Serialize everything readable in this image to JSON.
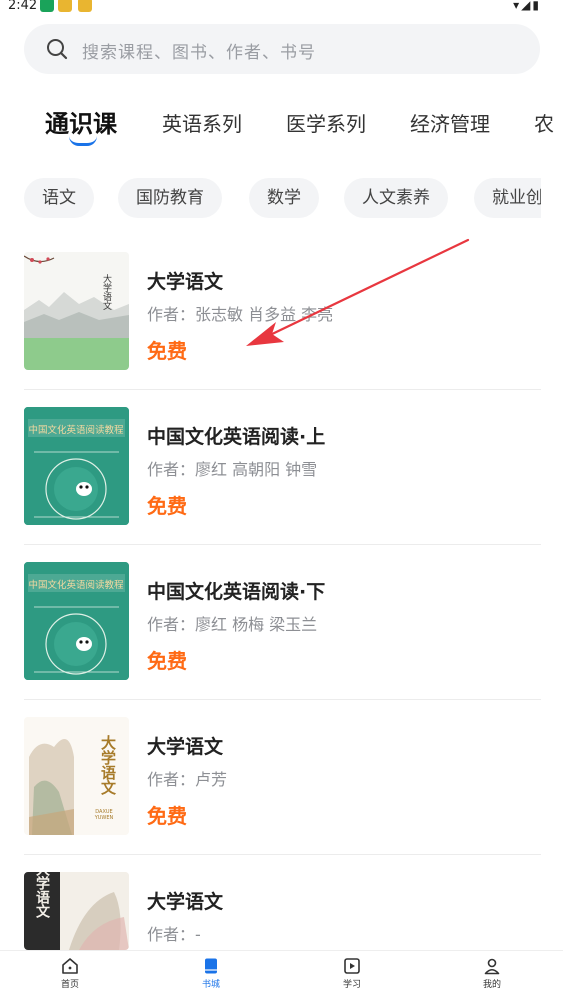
{
  "status": {
    "time": "2:42",
    "right_icons": "wifi signal battery"
  },
  "search": {
    "placeholder": "搜索课程、图书、作者、书号"
  },
  "tabs": [
    {
      "label": "通识课",
      "active": true
    },
    {
      "label": "英语系列",
      "active": false
    },
    {
      "label": "医学系列",
      "active": false
    },
    {
      "label": "经济管理",
      "active": false
    },
    {
      "label": "农",
      "active": false
    }
  ],
  "chips": [
    "语文",
    "国防教育",
    "数学",
    "人文素养",
    "就业创"
  ],
  "books": [
    {
      "title": "大学语文",
      "author": "作者：张志敏 肖多益 李亮",
      "price": "免费",
      "cover": "landscape"
    },
    {
      "title": "中国文化英语阅读·上",
      "author": "作者：廖红 高朝阳 钟雪",
      "price": "免费",
      "cover": "green-panda"
    },
    {
      "title": "中国文化英语阅读·下",
      "author": "作者：廖红 杨梅 梁玉兰",
      "price": "免费",
      "cover": "green-panda"
    },
    {
      "title": "大学语文",
      "author": "作者：卢芳",
      "price": "免费",
      "cover": "ink-painting"
    },
    {
      "title": "大学语文",
      "author": "作者：-",
      "price": "",
      "cover": "calligraphy"
    }
  ],
  "cover_texts": {
    "green_banner": "中国文化英语阅读教程",
    "daxue_yuwen": "大学语文",
    "daxue_pinyin": "DAXUE YUWEN"
  },
  "bottom_nav": [
    {
      "label": "首页",
      "icon": "home-icon",
      "active": false
    },
    {
      "label": "书城",
      "icon": "book-icon",
      "active": true
    },
    {
      "label": "学习",
      "icon": "play-icon",
      "active": false
    },
    {
      "label": "我的",
      "icon": "user-icon",
      "active": false
    }
  ],
  "colors": {
    "accent": "#1a73e8",
    "price": "#ff6a14",
    "annotation_arrow": "#e8373f",
    "cover_green": "#2e9a82"
  }
}
